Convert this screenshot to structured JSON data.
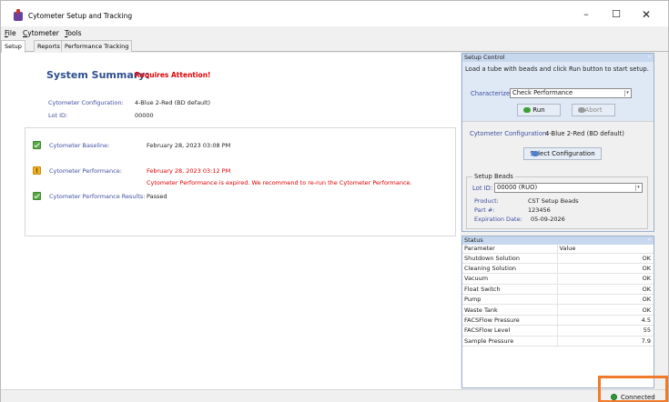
{
  "window": {
    "title": "Cytometer Setup and Tracking",
    "minimize": "–",
    "maximize": "☐",
    "close": "✕"
  },
  "menu": {
    "file": {
      "u": "F",
      "rest": "ile"
    },
    "cytometer": {
      "u": "C",
      "rest": "ytometer"
    },
    "tools": {
      "u": "T",
      "rest": "ools"
    }
  },
  "tabs": [
    "Setup",
    "Reports",
    "Performance Tracking"
  ],
  "summary": {
    "title": "System Summary:",
    "status": "Requires Attention!",
    "config_label": "Cytometer Configuration:",
    "config_value": "4-Blue 2-Red (BD default)",
    "lot_label": "Lot ID:",
    "lot_value": "00000"
  },
  "results": {
    "baseline_label": "Cytometer Baseline:",
    "baseline_value": "February 28, 2023 03:08 PM",
    "performance_label": "Cytometer Performance:",
    "performance_value": "February 28, 2023 03:12 PM",
    "performance_message": "Cytometer Performance is expired. We recommend to re-run the Cytometer Performance.",
    "results_label": "Cytometer Performance Results:",
    "results_value": "Passed"
  },
  "setup_control": {
    "header": "Setup Control",
    "pin": "ᵖ",
    "description": "Load a tube with beads and click Run button to start setup.",
    "characterize_label": "Characterize:",
    "characterize_value": "Check Performance",
    "run_label": "Run",
    "abort_label": "Abort",
    "config_label": "Cytometer Configuration:",
    "config_value": "4-Blue 2-Red (BD default)",
    "select_config_label": "Select Configuration",
    "beads_legend": "Setup Beads",
    "lot_label": "Lot ID:",
    "lot_value": "00000 (RUO)",
    "product_label": "Product:",
    "product_value": "CST Setup Beads",
    "part_label": "Part #:",
    "part_value": "123456",
    "exp_label": "Expiration Date:",
    "exp_value": "05-09-2026"
  },
  "status": {
    "header": "Status",
    "pin": "ᵖ",
    "col_parameter": "Parameter",
    "col_value": "Value",
    "rows": [
      {
        "parameter": "Shutdown Solution",
        "value": "OK"
      },
      {
        "parameter": "Cleaning Solution",
        "value": "OK"
      },
      {
        "parameter": "Vacuum",
        "value": "OK"
      },
      {
        "parameter": "Float Switch",
        "value": "OK"
      },
      {
        "parameter": "Pump",
        "value": "OK"
      },
      {
        "parameter": "Waste Tank",
        "value": "OK"
      },
      {
        "parameter": "FACSFlow Pressure",
        "value": "4.5"
      },
      {
        "parameter": "FACSFlow Level",
        "value": "55"
      },
      {
        "parameter": "Sample Pressure",
        "value": "7.9"
      }
    ]
  },
  "statusbar": {
    "connection": "Connected"
  }
}
